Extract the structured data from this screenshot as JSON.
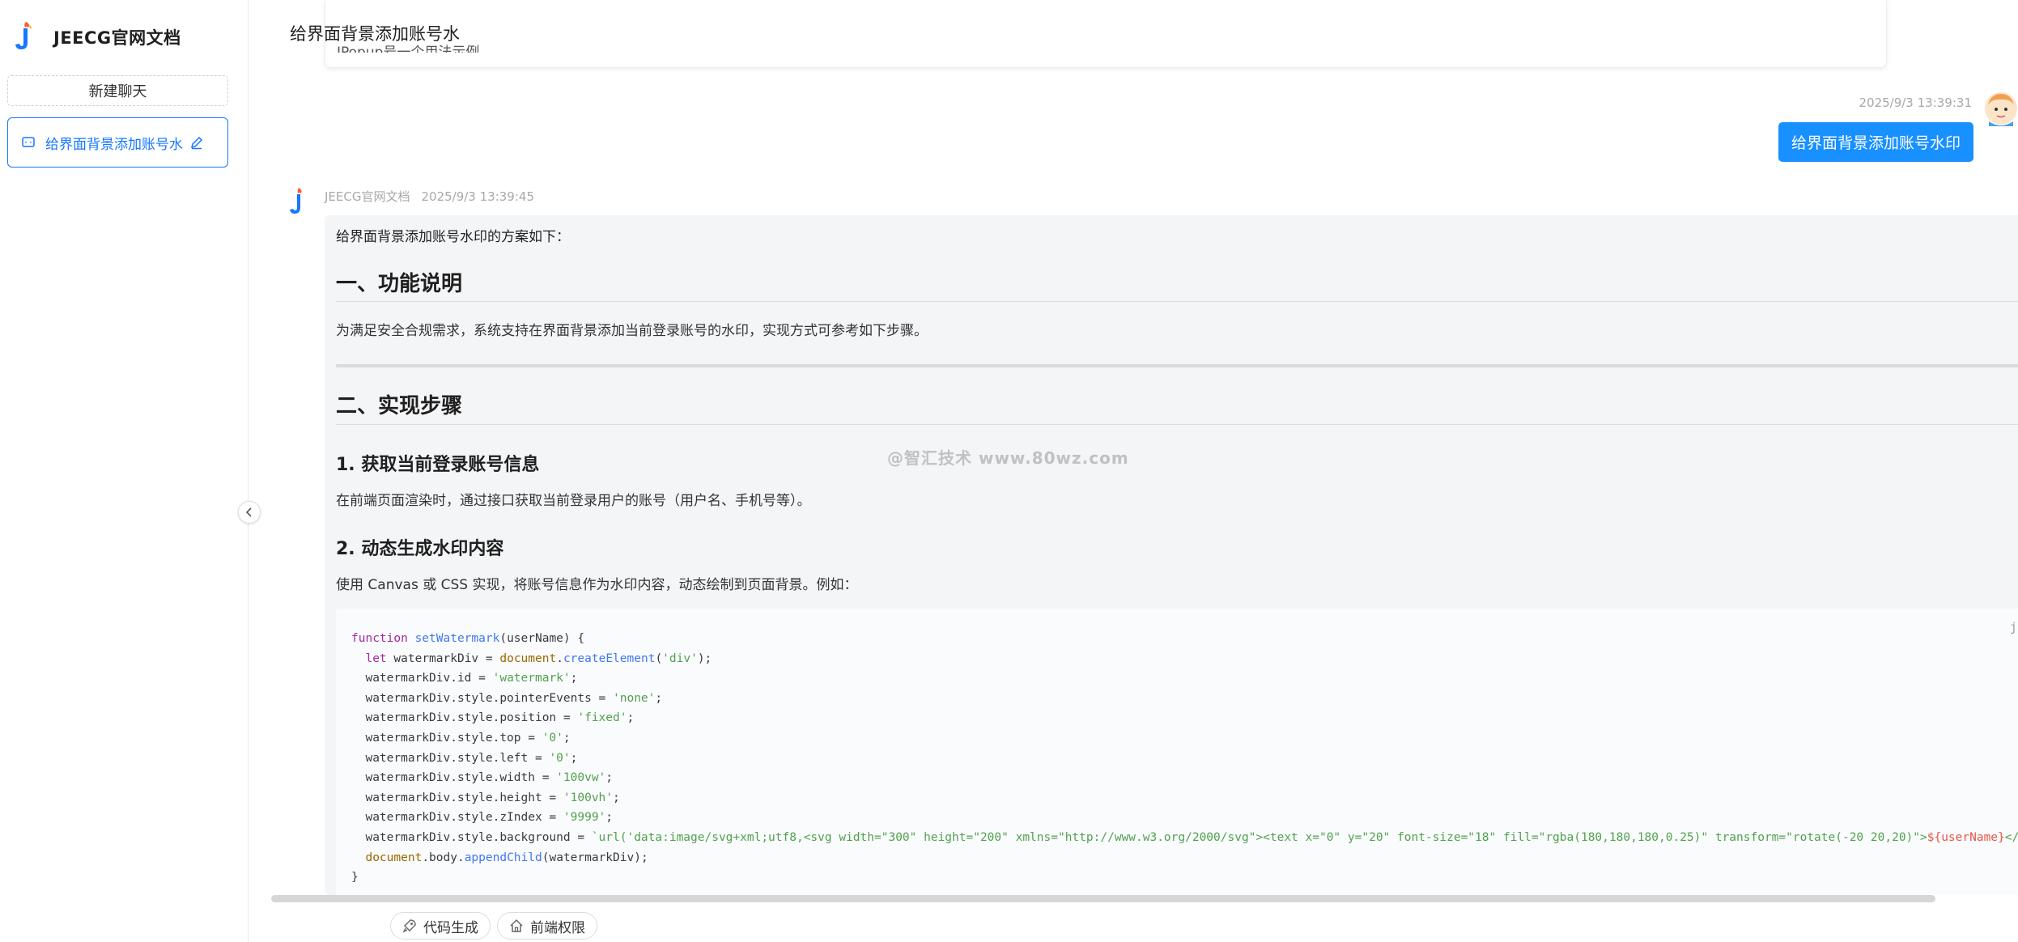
{
  "app": {
    "name": "JEECG官网文档"
  },
  "sidebar": {
    "new_chat_label": "新建聊天",
    "chats": [
      {
        "title": "给界面背景添加账号水"
      }
    ]
  },
  "header": {
    "title": "给界面背景添加账号水"
  },
  "previous_card": {
    "text": "JPopup号一个用法示例"
  },
  "user_message": {
    "time": "2025/9/3 13:39:31",
    "text": "给界面背景添加账号水印"
  },
  "bot_message": {
    "name": "JEECG官网文档",
    "time": "2025/9/3 13:39:45",
    "intro": "给界面背景添加账号水印的方案如下：",
    "h1": "一、功能说明",
    "p1": "为满足安全合规需求，系统支持在界面背景添加当前登录账号的水印，实现方式可参考如下步骤。",
    "h2": "二、实现步骤",
    "step1_title": "1. 获取当前登录账号信息",
    "step1_text": "在前端页面渲染时，通过接口获取当前登录用户的账号（用户名、手机号等）。",
    "step2_title": "2. 动态生成水印内容",
    "step2_text": "使用 Canvas 或 CSS 实现，将账号信息作为水印内容，动态绘制到页面背景。例如：",
    "code_lang": "js 复",
    "code_lines": [
      "function setWatermark(userName) {",
      "  let watermarkDiv = document.createElement('div');",
      "  watermarkDiv.id = 'watermark';",
      "  watermarkDiv.style.pointerEvents = 'none';",
      "  watermarkDiv.style.position = 'fixed';",
      "  watermarkDiv.style.top = '0';",
      "  watermarkDiv.style.left = '0';",
      "  watermarkDiv.style.width = '100vw';",
      "  watermarkDiv.style.height = '100vh';",
      "  watermarkDiv.style.zIndex = '9999';",
      "  watermarkDiv.style.background = `url('data:image/svg+xml;utf8,<svg width=\"300\" height=\"200\" xmlns=\"http://www.w3.org/2000/svg\"><text x=\"0\" y=\"20\" font-size=\"18\" fill=\"rgba(180,180,180,0.25)\" transform=\"rotate(-20 20,20)\">${userName}</text></svg>') re",
      "  document.body.appendChild(watermarkDiv);",
      "}"
    ]
  },
  "watermark_text": "@智汇技术 www.80wz.com",
  "toolbar": {
    "code_gen_label": "代码生成",
    "frontend_perm_label": "前端权限"
  },
  "colors": {
    "accent": "#1677ff",
    "user_bubble": "#1890ff"
  }
}
